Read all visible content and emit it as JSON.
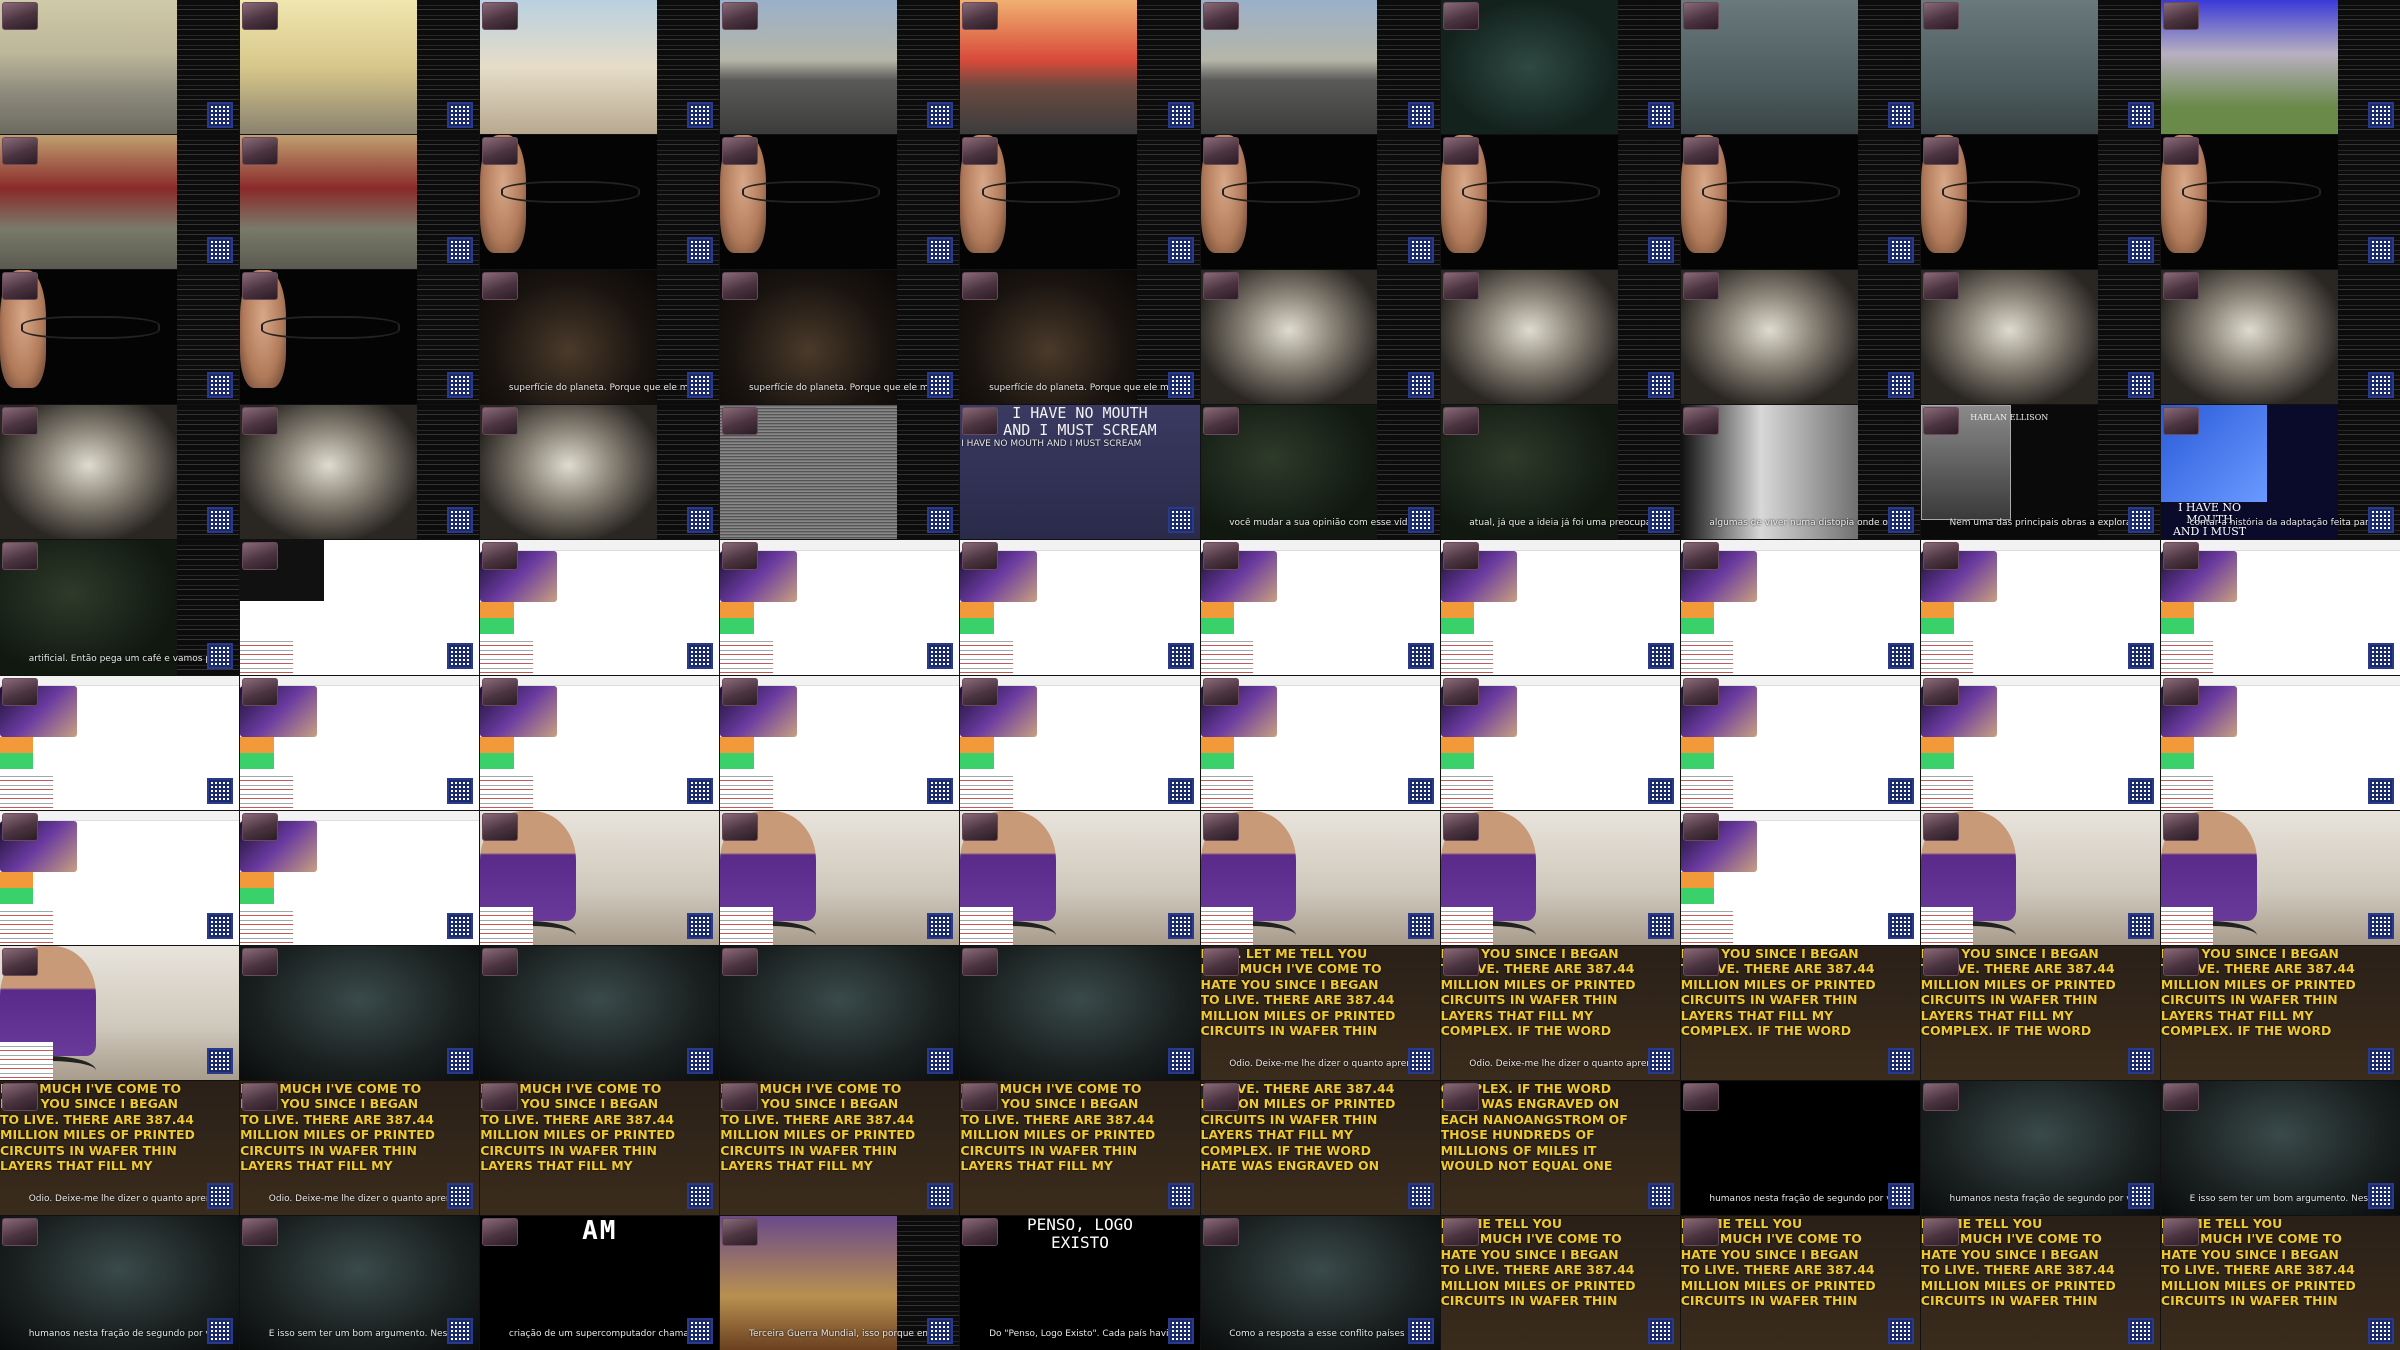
{
  "sheet": {
    "columns": 10,
    "rows": 10
  },
  "texts": {
    "title_card": "I HAVE NO MOUTH\nAND I MUST SCREAM",
    "title_card_caption": "I HAVE NO MOUTH AND I MUST SCREAM",
    "book_cover": "I HAVE NO\nMOUTH\nAND I MUST\nSCREAM",
    "book_author": "HARLAN ELLISON",
    "am_card": "AM",
    "penso_card": "PENSO, LOGO\nEXISTO",
    "hate_monologue_a": "HATE. LET ME TELL YOU\nHOW MUCH I'VE COME TO\nHATE YOU SINCE I BEGAN\nTO LIVE. THERE ARE 387.44\nMILLION MILES OF PRINTED\nCIRCUITS IN WAFER THIN",
    "hate_monologue_b": "HATE YOU SINCE I BEGAN\nTO LIVE. THERE ARE 387.44\nMILLION MILES OF PRINTED\nCIRCUITS IN WAFER THIN\nLAYERS THAT FILL MY\nCOMPLEX. IF THE WORD",
    "hate_monologue_c": "HOW MUCH I'VE COME TO\nHATE YOU SINCE I BEGAN\nTO LIVE. THERE ARE 387.44\nMILLION MILES OF PRINTED\nCIRCUITS IN WAFER THIN\nLAYERS THAT FILL MY",
    "hate_monologue_d": "COMPLEX. IF THE WORD\nHATE WAS ENGRAVED ON\nEACH NANOANGSTROM OF\nTHOSE HUNDREDS OF\nMILLIONS OF MILES IT\nWOULD NOT EQUAL ONE",
    "hate_monologue_e": "TO LIVE. THERE ARE 387.44\nMILLION MILES OF PRINTED\nCIRCUITS IN WAFER THIN\nLAYERS THAT FILL MY\nCOMPLEX. IF THE WORD\nHATE WAS ENGRAVED ON",
    "hate_monologue_f": "HOW MUCH I'VE COME TO\nHATE YOU SINCE I BEGAN\nTO LIVE. THERE ARE 387.44\nMILLION MILES OF PRINTED\nCIRCUITS IN WAFER THIN\nLAYERS THAT FILL MY\n...ORD",
    "hate_monologue_g": "LET ME TELL YOU\nHOW MUCH I'VE COME TO\nHATE YOU SINCE I BEGAN\nTO LIVE. THERE ARE 387.44\nMILLION MILES OF PRINTED\nCIRCUITS IN WAFER THIN",
    "sub_pt_1": "Ódio. Deixe-me lhe dizer o quanto aprendi a odiá-lo desde que comecei a existir. Há mais de",
    "sub_pt_2": "humanos nesta fração de segundo por você. Ódio. Ódio.",
    "sub_pt_3": "E isso sem ter um bom argumento. Nessa distopia que",
    "sub_pt_4": "Como a resposta a esse conflito países como China, Rússia e Estados Unidos se dedicaram a",
    "sub_pt_5": "criação de um supercomputador chamado \"Allied Mastercomputer\", ou AM.",
    "sub_pt_6": "Terceira Guerra Mundial, isso porque em um determinado dia o AM adquiriu consciência.",
    "sub_pt_7": "Do \"Penso, Logo Existo\". Cada país havia desenvolvido um supercomputador",
    "sub_pt_8": "superfície do planeta. Porque que ele mantém esses humanos vivos",
    "sub_pt_9": "artificial. Então pega um café e vamos para o vídeo porque a história é longa",
    "sub_pt_10": "você mudar a sua opinião com esse vídeo. Muito se fala sobre o dia em que as máquinas vão acabar",
    "sub_pt_11": "atual, já que a ideia já foi uma preocupação expressada pelo próprio Stephen Hawking. E",
    "sub_pt_12": "algumas de viver numa distopia onde o mundo foi dominado por uma máquina. Seu livro intitulado",
    "sub_pt_13": "contar a história da adaptação feita para videogame desse livro de mesmo nome que",
    "sub_pt_14": "Nem uma das principais obras a explorarem esse tipo de distopia. E eu sei que com o nome desse livro"
  },
  "colors": {
    "scroll_text": "#f0c830",
    "web_orange": "#f29a3a",
    "web_green": "#3ad06a",
    "shirt_purple": "#6a3a9a"
  }
}
